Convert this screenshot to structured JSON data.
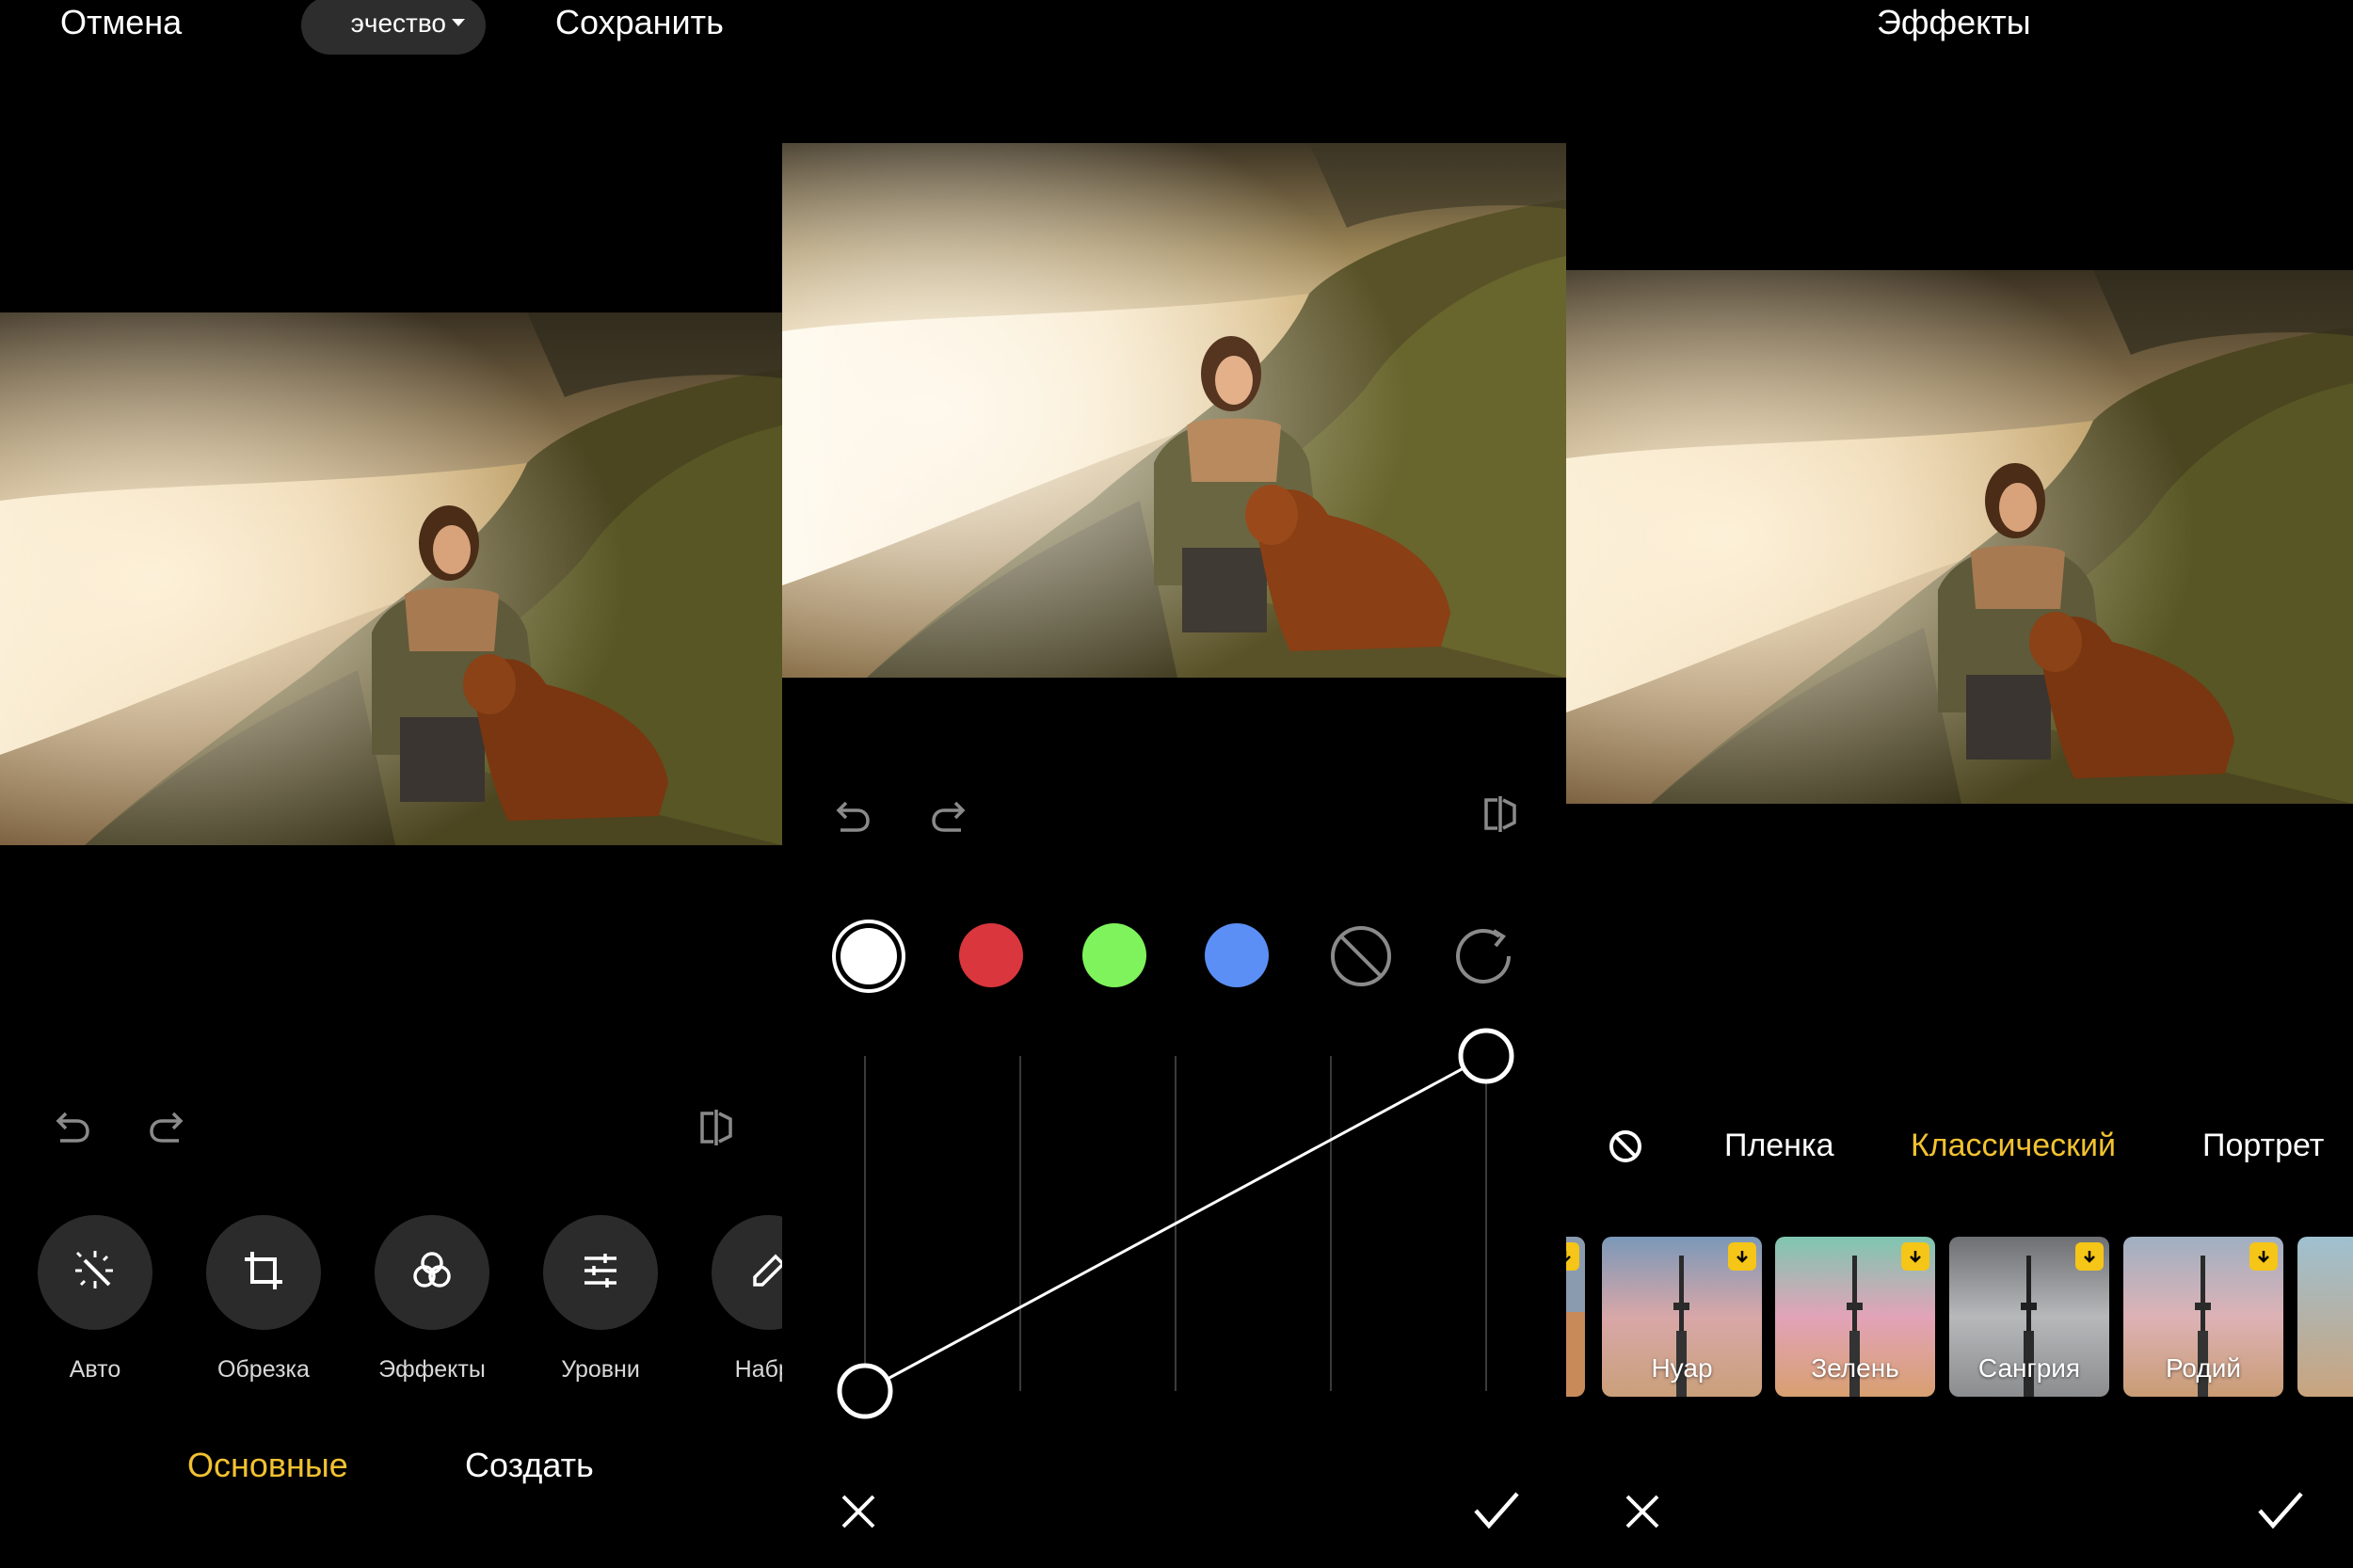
{
  "panel1": {
    "cancel_label": "Отмена",
    "quality_label": "эчество",
    "save_label": "Сохранить",
    "tools": [
      {
        "icon": "magic-wand-icon",
        "label": "Авто"
      },
      {
        "icon": "crop-icon",
        "label": "Обрезка"
      },
      {
        "icon": "effects-icon",
        "label": "Эффекты"
      },
      {
        "icon": "levels-icon",
        "label": "Уровни"
      },
      {
        "icon": "draw-icon",
        "label": "Набрс"
      }
    ],
    "tabs": [
      {
        "label": "Основные",
        "active": true
      },
      {
        "label": "Создать",
        "active": false
      }
    ]
  },
  "panel2": {
    "swatches": [
      {
        "name": "white",
        "color": "#ffffff",
        "selected": true
      },
      {
        "name": "red",
        "color": "#d9363e"
      },
      {
        "name": "green",
        "color": "#7ef35c"
      },
      {
        "name": "blue",
        "color": "#5b8ff5"
      }
    ],
    "curve": {
      "start": [
        0,
        0
      ],
      "end": [
        1,
        1
      ]
    },
    "icons": [
      "undo-icon",
      "redo-icon",
      "compare-icon",
      "disable-icon",
      "reset-icon",
      "close-icon",
      "confirm-icon"
    ]
  },
  "panel3": {
    "title": "Эффекты",
    "categories": [
      {
        "label": "Пленка",
        "active": false
      },
      {
        "label": "Классический",
        "active": true
      },
      {
        "label": "Портрет",
        "active": false
      }
    ],
    "filters": [
      "Нуар",
      "Зелень",
      "Сангрия",
      "Родий"
    ]
  },
  "colors": {
    "accent": "#f2c230",
    "background": "#000000",
    "button_bg": "#2b2b2b",
    "icon_gray": "#8a8a8a"
  }
}
